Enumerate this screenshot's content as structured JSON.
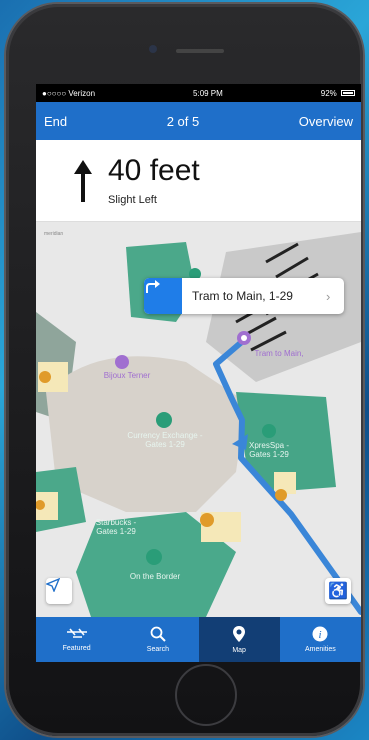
{
  "status_bar": {
    "carrier": "●○○○○ Verizon",
    "time": "5:09 PM",
    "battery": "92%"
  },
  "nav": {
    "left": "End",
    "center": "2 of 5",
    "right": "Overview"
  },
  "direction": {
    "distance": "40 feet",
    "instruction": "Slight Left"
  },
  "map": {
    "callout": "Tram to Main, 1-29",
    "watermark": "meridian",
    "labels": {
      "bijoux": "Bijoux Terner",
      "currency": "Currency Exchange - Gates 1-29",
      "spa": "XpresSpa - Gates 1-29",
      "starbucks": "Starbucks - Gates 1-29",
      "border": "On the Border",
      "tram": "Tram to Main,"
    },
    "route_color": "#3a86d8",
    "accent_color": "#2a9d78"
  },
  "tabs": [
    {
      "label": "Featured",
      "icon": "airplanes-icon"
    },
    {
      "label": "Search",
      "icon": "search-icon"
    },
    {
      "label": "Map",
      "icon": "map-pin-icon"
    },
    {
      "label": "Amenities",
      "icon": "info-icon"
    }
  ],
  "active_tab": "Map"
}
